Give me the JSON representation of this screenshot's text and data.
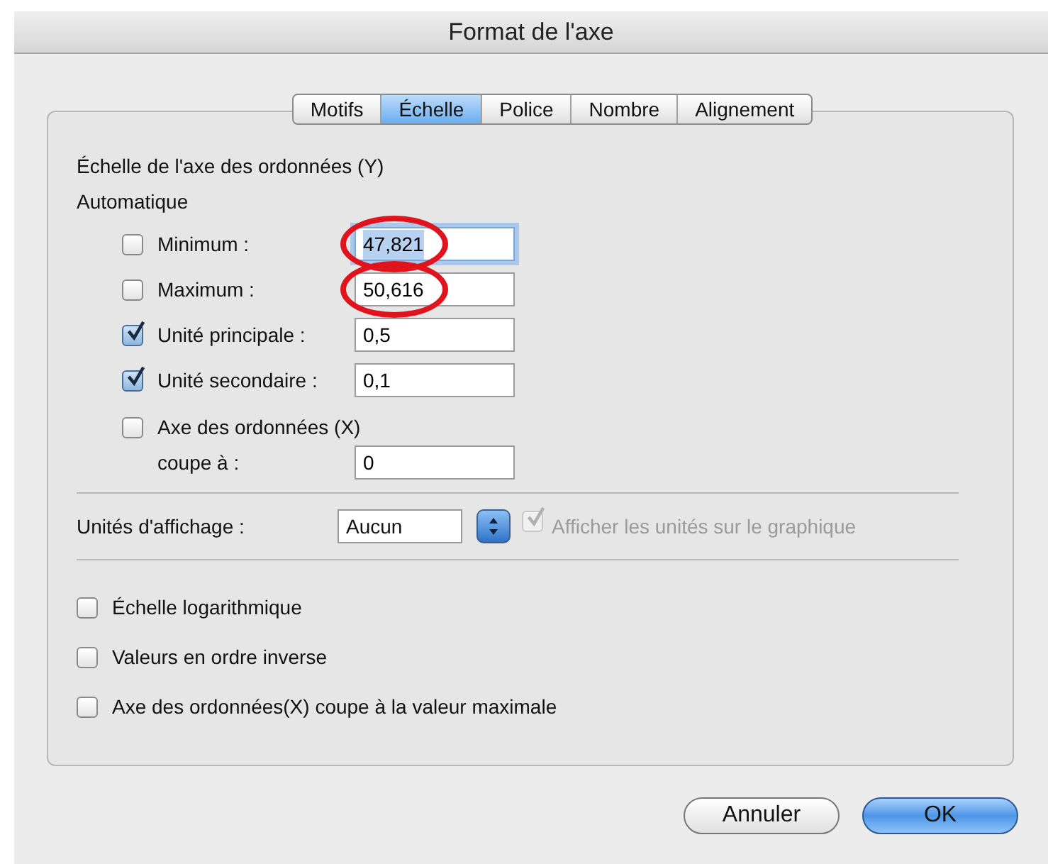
{
  "window": {
    "title": "Format de l'axe"
  },
  "tabs": [
    {
      "label": "Motifs",
      "selected": false
    },
    {
      "label": "Échelle",
      "selected": true
    },
    {
      "label": "Police",
      "selected": false
    },
    {
      "label": "Nombre",
      "selected": false
    },
    {
      "label": "Alignement",
      "selected": false
    }
  ],
  "section": {
    "title": "Échelle de l'axe des ordonnées (Y)",
    "subtitle": "Automatique"
  },
  "rows": [
    {
      "label": "Minimum :",
      "checked": false,
      "value": "47,821",
      "focused": true,
      "circled": true
    },
    {
      "label": "Maximum :",
      "checked": false,
      "value": "50,616",
      "focused": false,
      "circled": true
    },
    {
      "label": "Unité principale :",
      "checked": true,
      "value": "0,5",
      "focused": false,
      "circled": false
    },
    {
      "label": "Unité secondaire :",
      "checked": true,
      "value": "0,1",
      "focused": false,
      "circled": false
    }
  ],
  "crosses": {
    "label": "Axe des ordonnées (X)",
    "checked": false,
    "sublabel": "coupe à :",
    "value": "0"
  },
  "display_units": {
    "label": "Unités d'affichage :",
    "value": "Aucun",
    "show_label": "Afficher les unités sur le graphique",
    "show_checked": true,
    "show_disabled": true
  },
  "options": [
    {
      "label": "Échelle logarithmique",
      "checked": false
    },
    {
      "label": "Valeurs en ordre inverse",
      "checked": false
    },
    {
      "label": "Axe des ordonnées(X) coupe à la valeur maximale",
      "checked": false
    }
  ],
  "buttons": [
    {
      "label": "Annuler",
      "kind": "cancel"
    },
    {
      "label": "OK",
      "kind": "default"
    }
  ]
}
